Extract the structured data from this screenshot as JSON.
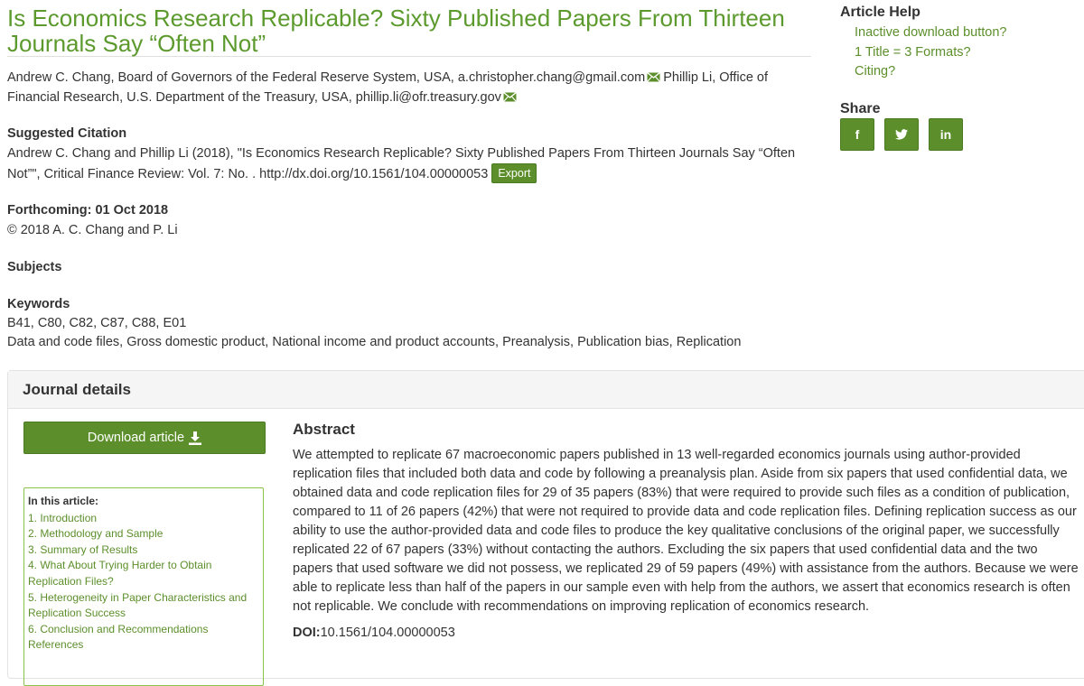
{
  "article": {
    "title": "Is Economics Research Replicable? Sixty Published Papers From Thirteen Journals Say “Often Not”",
    "authors_part1": "Andrew C. Chang, Board of Governors of the Federal Reserve System, USA, a.christopher.chang@gmail.com",
    "authors_part2": "Phillip Li, Office of Financial Research, U.S. Department of the Treasury, USA, phillip.li@ofr.treasury.gov"
  },
  "citation": {
    "heading": "Suggested Citation",
    "text": "Andrew C. Chang and Phillip Li (2018), \"Is Economics Research Replicable? Sixty Published Papers From Thirteen Journals Say “Often Not”\", Critical Finance Review: Vol. 7: No. . http://dx.doi.org/10.1561/104.00000053",
    "export_label": "Export"
  },
  "forthcoming": {
    "heading": "Forthcoming: 01 Oct 2018",
    "copyright": "© 2018 A. C. Chang and P. Li"
  },
  "subjects": {
    "heading": "Subjects"
  },
  "keywords": {
    "heading": "Keywords",
    "codes": "B41, C80, C82, C87, C88, E01",
    "terms": "Data and code files, Gross domestic product, National income and product accounts, Preanalysis, Publication bias, Replication"
  },
  "sidebar": {
    "help_heading": "Article Help",
    "help_links": [
      "Inactive download button?",
      "1 Title = 3 Formats?",
      "Citing?"
    ],
    "share_heading": "Share",
    "share_buttons": [
      "f",
      "in"
    ]
  },
  "journal": {
    "heading": "Journal details",
    "download_label": "Download article",
    "toc_heading": "In this article:",
    "toc_items": [
      "1. Introduction",
      "2. Methodology and Sample",
      "3. Summary of Results",
      "4. What About Trying Harder to Obtain Replication Files?",
      "5. Heterogeneity in Paper Characteristics and Replication Success",
      "6. Conclusion and Recommendations",
      "References"
    ],
    "abstract_heading": "Abstract",
    "abstract_text": "We attempted to replicate 67 macroeconomic papers published in 13 well-regarded economics journals using author-provided replication files that included both data and code by following a preanalysis plan. Aside from six papers that used confidential data, we obtained data and code replication files for 29 of 35 papers (83%) that were required to provide such files as a condition of publication, compared to 11 of 26 papers (42%) that were not required to provide data and code replication files. Defining replication success as our ability to use the author-provided data and code files to produce the key qualitative conclusions of the original paper, we successfully replicated 22 of 67 papers (33%) without contacting the authors. Excluding the six papers that used confidential data and the two papers that used software we did not possess, we replicated 29 of 59 papers (49%) with assistance from the authors. Because we were able to replicate less than half of the papers in our sample even with help from the authors, we assert that economics research is often not replicable. We conclude with recommendations on improving replication of economics research.",
    "doi_label": "DOI:",
    "doi_value": "10.1561/104.00000053"
  },
  "colors": {
    "accent": "#5c8f2b",
    "title": "#5c9a2e"
  }
}
